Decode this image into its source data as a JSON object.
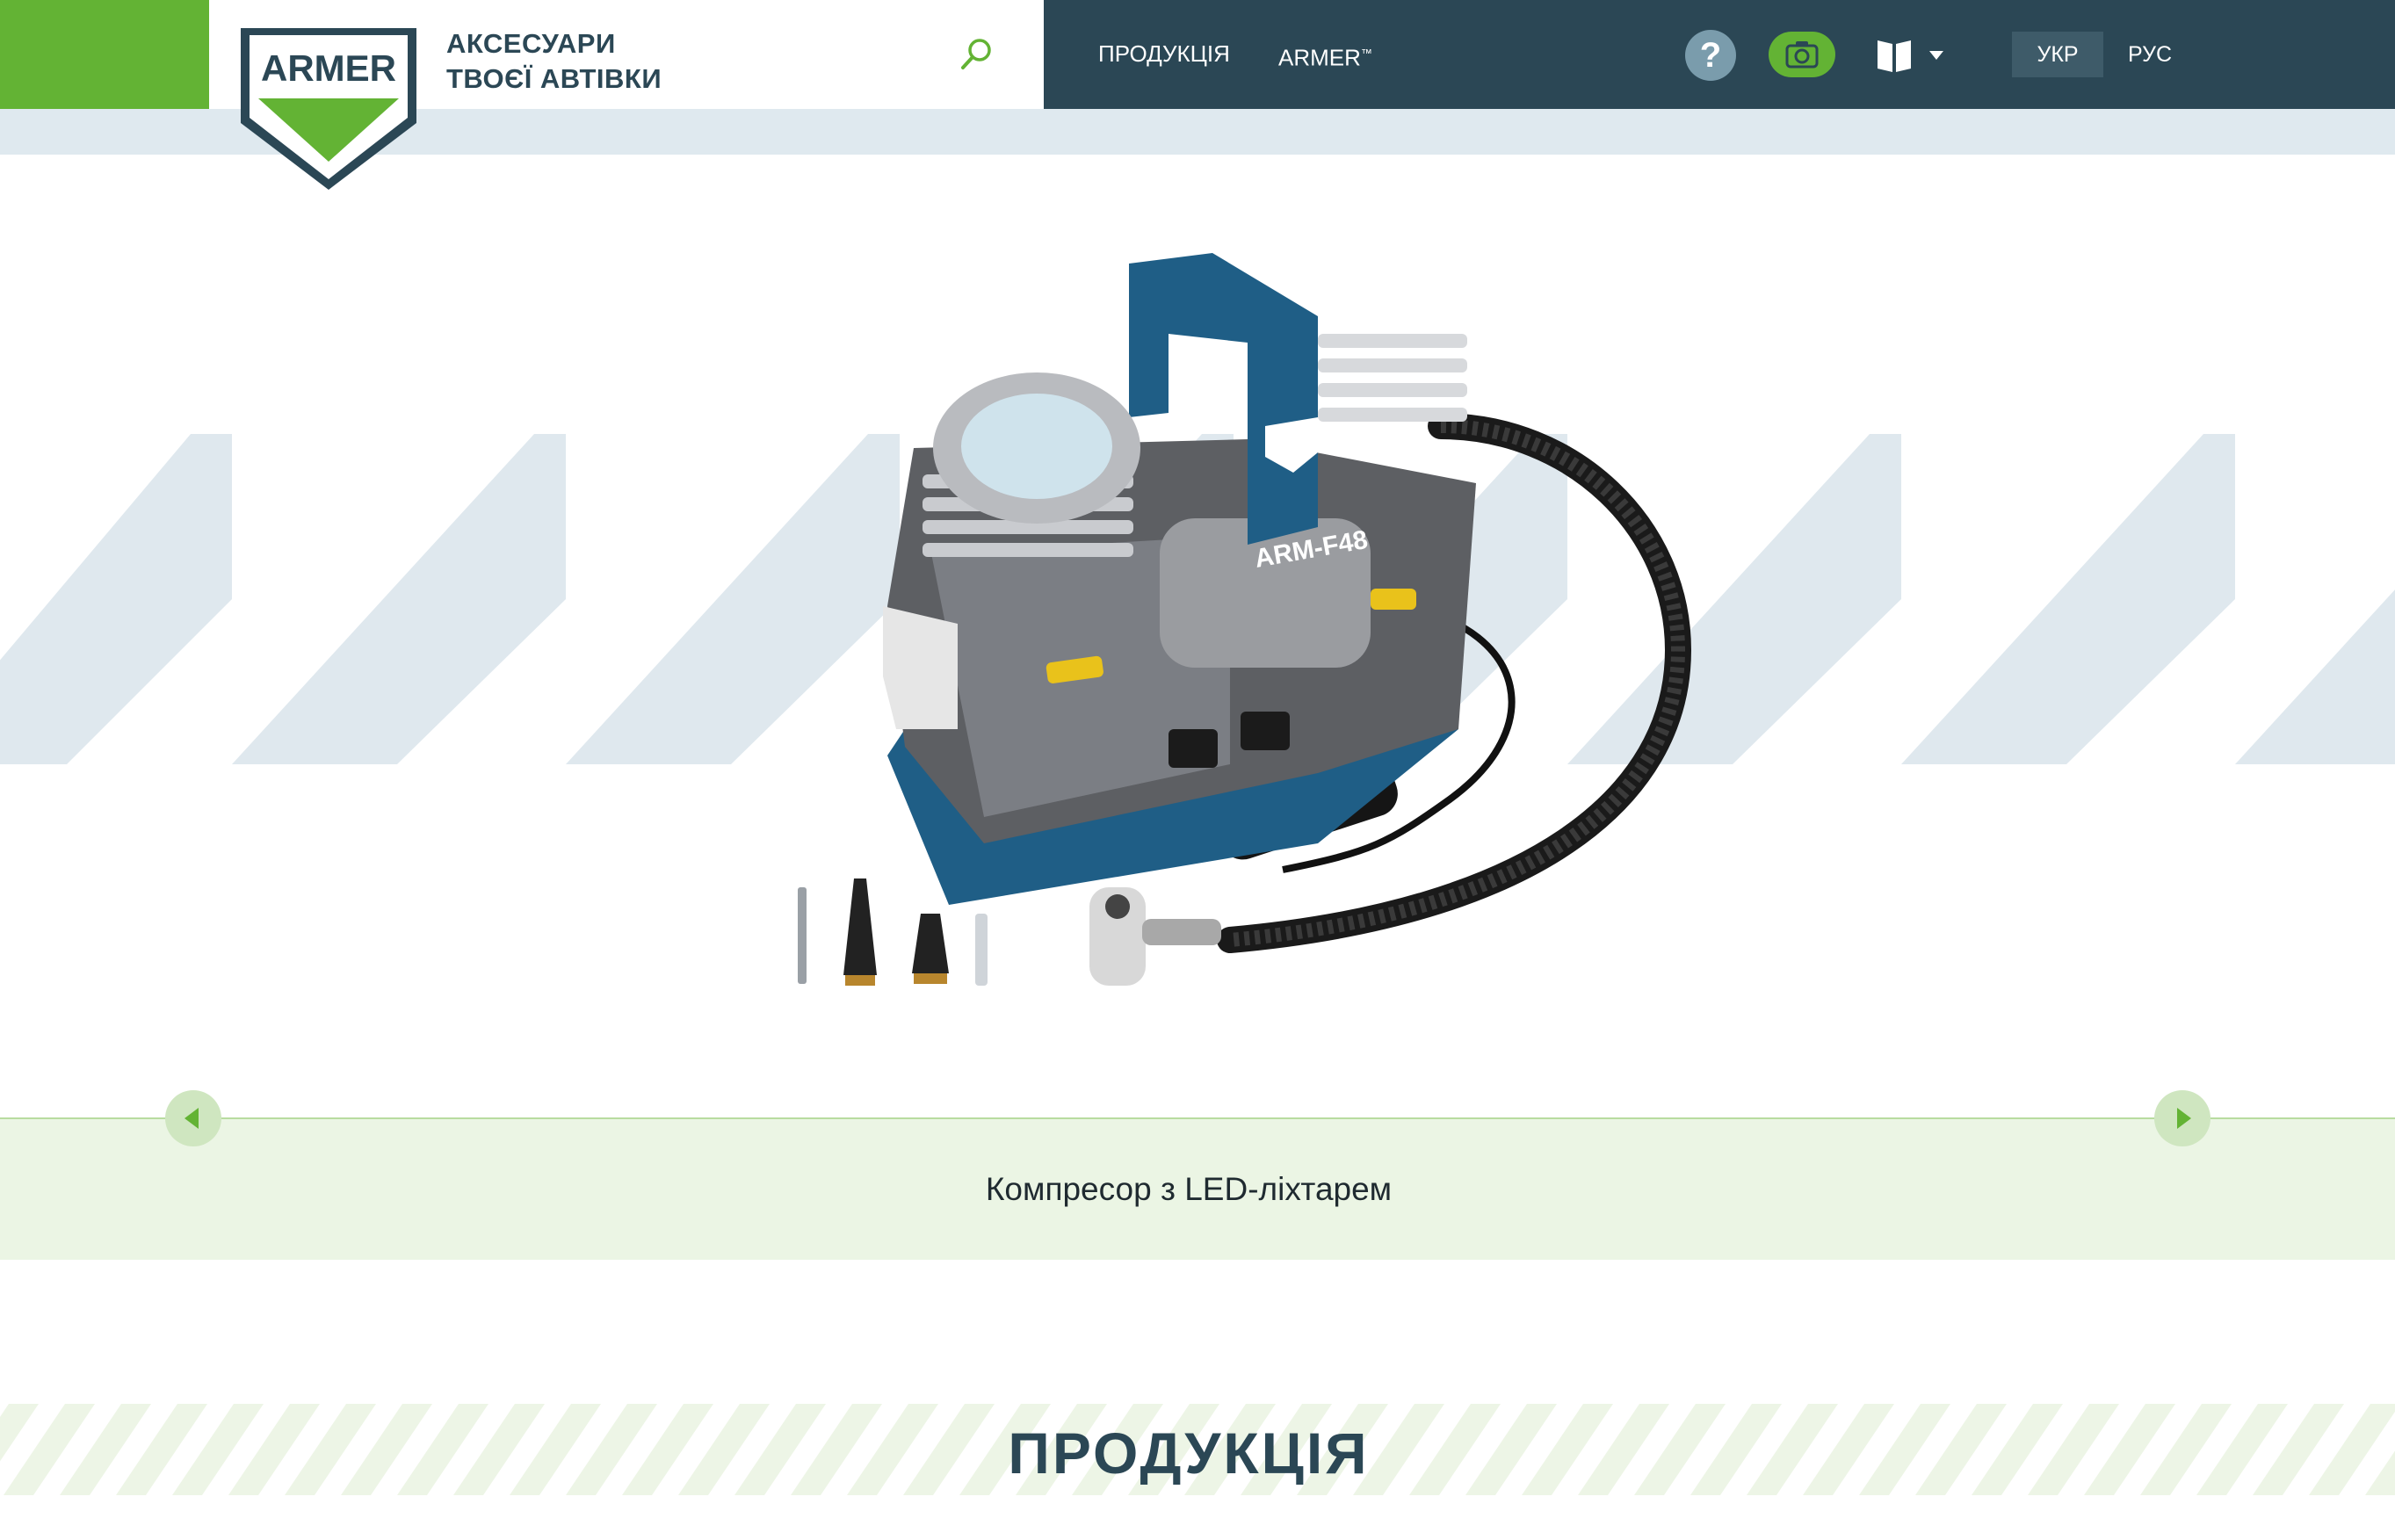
{
  "header": {
    "logo_text": "ARMER",
    "tagline_line1": "АКСЕСУАРИ",
    "tagline_line2": "ТВОЄЇ АВТІВКИ",
    "nav": {
      "products": "ПРОДУКЦІЯ",
      "armer": "ARMER",
      "armer_mark": "™"
    },
    "help_label": "?",
    "languages": [
      {
        "label": "УКР",
        "active": true
      },
      {
        "label": "РУС",
        "active": false
      }
    ],
    "icons": [
      "search-icon",
      "help-icon",
      "camera-icon",
      "book-icon",
      "chevron-down-icon"
    ]
  },
  "hero": {
    "product_model": "ARM-F48",
    "product_brand": "ARMER",
    "caption": "Компресор з LED-ліхтарем",
    "icons": [
      "arrow-left-icon",
      "arrow-right-icon"
    ]
  },
  "products_section": {
    "title": "ПРОДУКЦІЯ"
  },
  "colors": {
    "brand_green": "#63b334",
    "dark_navy": "#2b4755",
    "light_strip": "#dfe9ef",
    "caption_bg": "#ebf5e4",
    "stripe": "#dfe8ee",
    "product_blue": "#1f5e86"
  }
}
